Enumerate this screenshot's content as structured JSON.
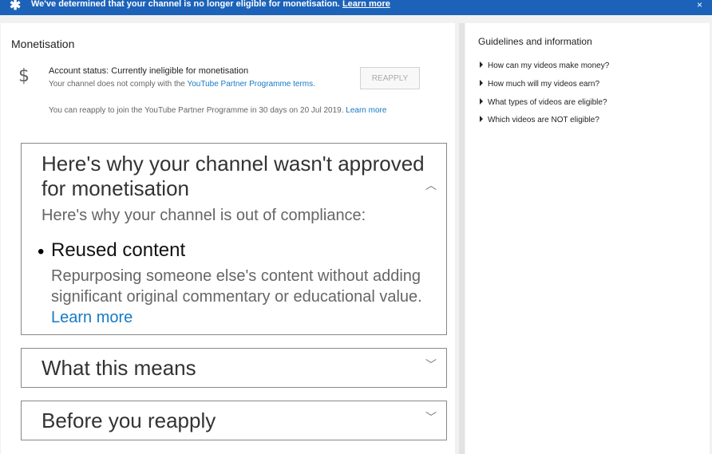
{
  "banner": {
    "message": "We've determined that your channel is no longer eligible for monetisation.",
    "link": "Learn more",
    "close": "×",
    "icon": "star-icon"
  },
  "monetisation": {
    "title": "Monetisation",
    "dollar_icon": "$",
    "status": "Account status: Currently ineligible for monetisation",
    "comply_prefix": "Your channel does not comply with the",
    "comply_link": "YouTube Partner Programme terms",
    "comply_suffix": ".",
    "reapply_button": "REAPPLY",
    "reapply_info": "You can reapply to join the YouTube Partner Programme in 30 days on 20 Jul 2019.",
    "reapply_link": "Learn more"
  },
  "cards": {
    "why": {
      "title": "Here's why your channel wasn't approved for monetisation",
      "subtitle": "Here's why your channel is out of compliance:",
      "reason": "Reused content",
      "reason_desc": "Repurposing someone else's content without adding significant original commentary or educational value.",
      "reason_link": "Learn more",
      "chevron": "^"
    },
    "means": {
      "title": "What this means",
      "chevron": "⌄"
    },
    "before": {
      "title": "Before you reapply",
      "chevron": "⌄"
    }
  },
  "guidelines": {
    "title": "Guidelines and information",
    "items": [
      "How can my videos make money?",
      "How much will my videos earn?",
      "What types of videos are eligible?",
      "Which videos are NOT eligible?"
    ]
  }
}
